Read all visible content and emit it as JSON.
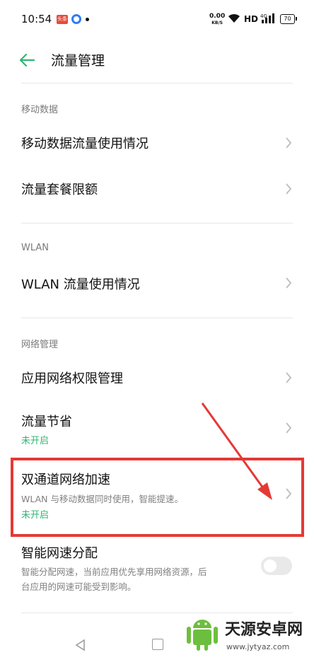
{
  "status_bar": {
    "time": "10:54",
    "red_notification_text": "头条",
    "net_speed_value": "0.00",
    "net_speed_unit": "KB/S",
    "hd_label": "HD",
    "battery_level": "70"
  },
  "header": {
    "title": "流量管理"
  },
  "sections": {
    "mobile_data": {
      "header": "移动数据",
      "items": [
        {
          "title": "移动数据流量使用情况"
        },
        {
          "title": "流量套餐限额"
        }
      ]
    },
    "wlan": {
      "header": "WLAN",
      "items": [
        {
          "title": "WLAN 流量使用情况"
        }
      ]
    },
    "network": {
      "header": "网络管理",
      "items": [
        {
          "title": "应用网络权限管理"
        },
        {
          "title": "流量节省",
          "status": "未开启"
        },
        {
          "title": "双通道网络加速",
          "subtitle": "WLAN 与移动数据同时使用，智能提速。",
          "status": "未开启"
        },
        {
          "title": "智能网速分配",
          "subtitle_line1": "智能分配网速，当前应用优先享用网络资源，后",
          "subtitle_line2": "台应用的网速可能受到影响。",
          "toggle_on": false
        }
      ]
    }
  },
  "colors": {
    "accent": "#2fb572",
    "highlight": "#e53935"
  },
  "watermark": {
    "name": "天源安卓网",
    "url": "www.jytyaz.com"
  }
}
